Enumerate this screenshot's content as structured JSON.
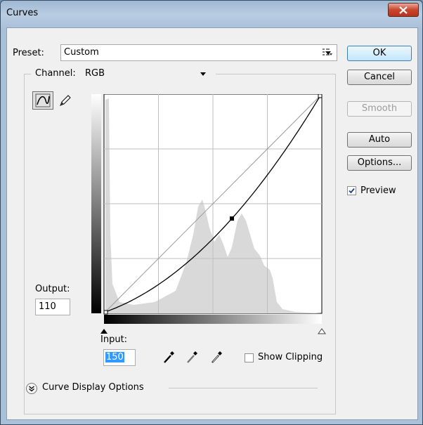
{
  "window": {
    "title": "Curves"
  },
  "preset": {
    "label": "Preset:",
    "value": "Custom"
  },
  "channel": {
    "label": "Channel:",
    "value": "RGB"
  },
  "buttons": {
    "ok": "OK",
    "cancel": "Cancel",
    "smooth": "Smooth",
    "auto": "Auto",
    "options": "Options..."
  },
  "preview": {
    "label": "Preview",
    "checked": true
  },
  "output": {
    "label": "Output:",
    "value": "110"
  },
  "input": {
    "label": "Input:",
    "value": "150"
  },
  "show_clipping": {
    "label": "Show Clipping",
    "checked": false
  },
  "curve_display_options": {
    "label": "Curve Display Options"
  },
  "chart_data": {
    "type": "line",
    "xlim": [
      0,
      255
    ],
    "ylim": [
      0,
      255
    ],
    "grid_divisions": 4,
    "curve_points": [
      [
        0,
        0
      ],
      [
        150,
        110
      ],
      [
        255,
        255
      ]
    ],
    "selected_point": [
      150,
      110
    ],
    "histogram_color": "#d9d9d9"
  }
}
